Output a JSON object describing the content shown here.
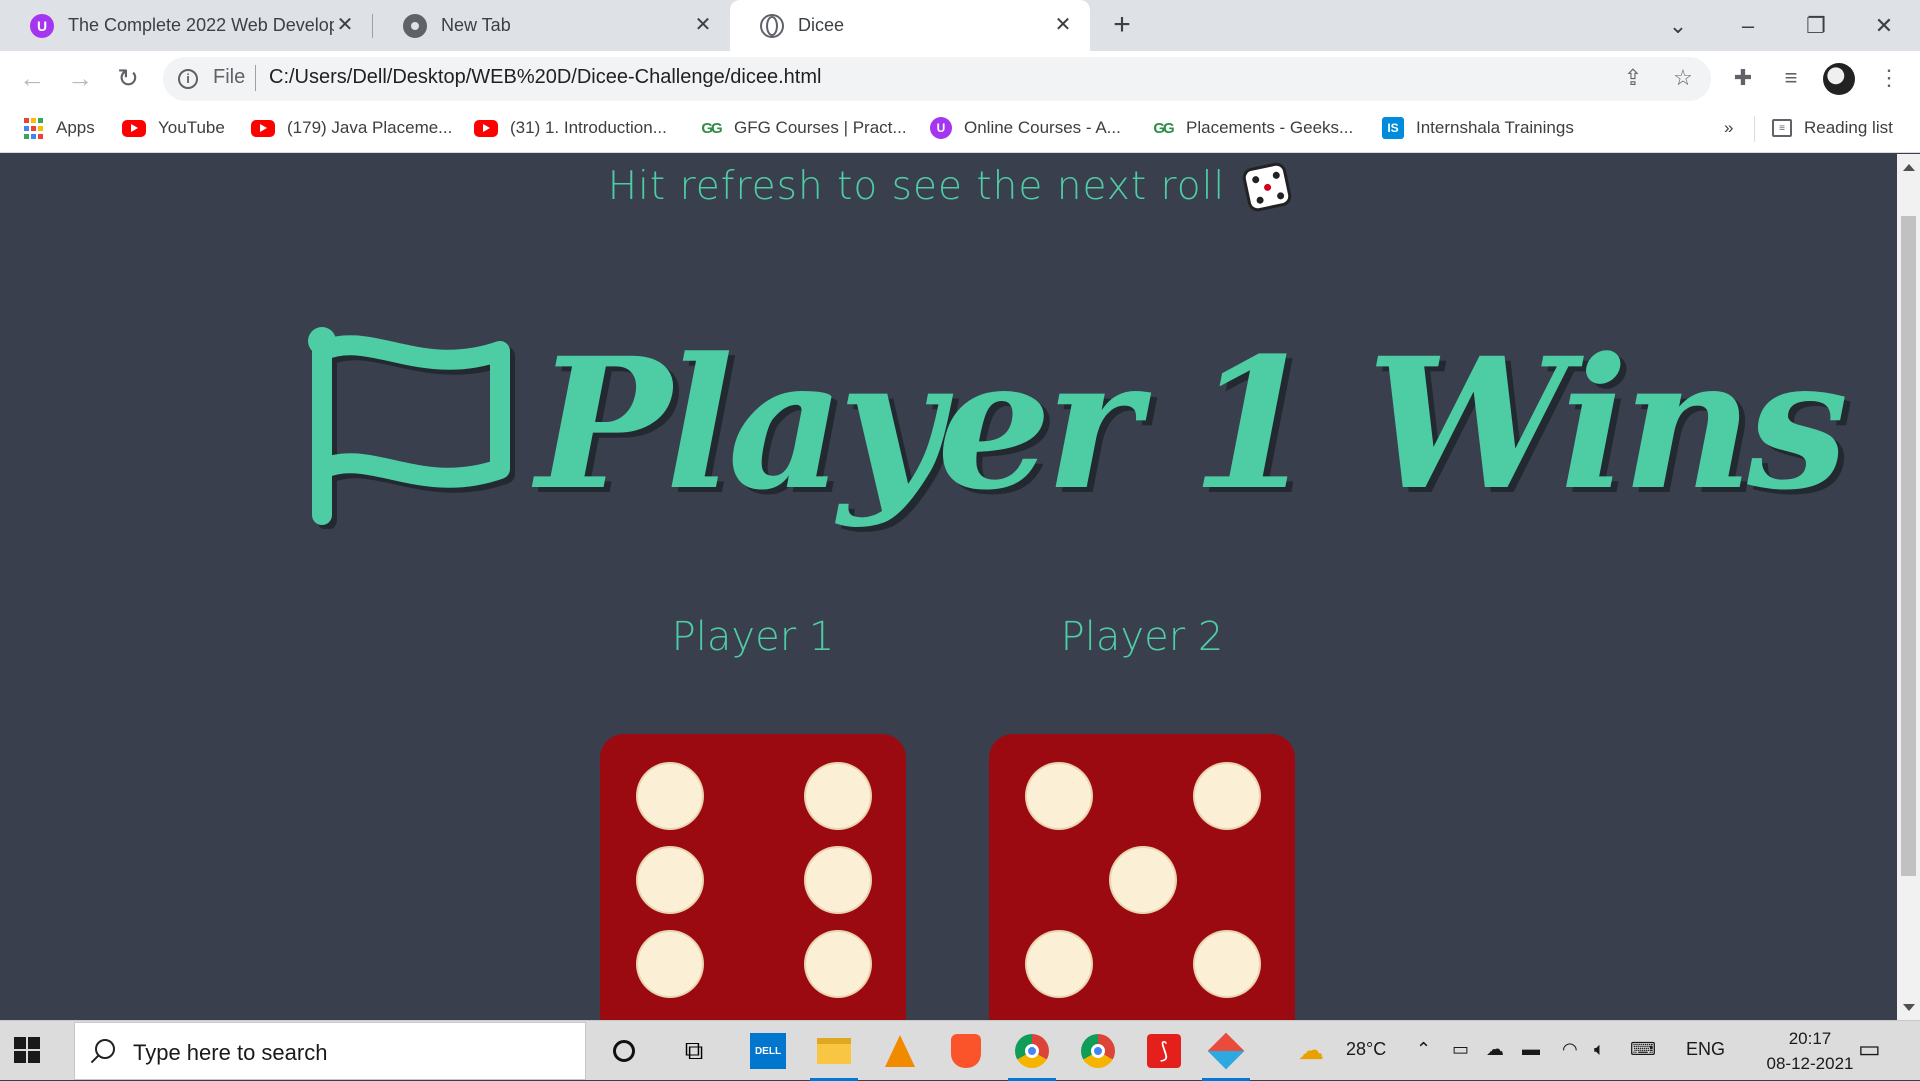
{
  "browser": {
    "tabs": [
      {
        "title": "The Complete 2022 Web Develop",
        "favicon": "udemy-icon",
        "active": false
      },
      {
        "title": "New Tab",
        "favicon": "chrome-icon",
        "active": false
      },
      {
        "title": "Dicee",
        "favicon": "globe-icon",
        "active": true
      }
    ],
    "new_tab_label": "+",
    "address": {
      "scheme_label": "File",
      "url": "C:/Users/Dell/Desktop/WEB%20D/Dicee-Challenge/dicee.html"
    },
    "bookmarks": [
      {
        "label": "Apps",
        "icon": "apps-grid-icon"
      },
      {
        "label": "YouTube",
        "icon": "youtube-icon"
      },
      {
        "label": "(179) Java Placeme...",
        "icon": "youtube-icon"
      },
      {
        "label": "(31) 1. Introduction...",
        "icon": "youtube-icon"
      },
      {
        "label": "GFG Courses | Pract...",
        "icon": "gfg-icon"
      },
      {
        "label": "Online Courses - A...",
        "icon": "udemy-icon"
      },
      {
        "label": "Placements - Geeks...",
        "icon": "gfg-icon"
      },
      {
        "label": "Internshala Trainings",
        "icon": "internshala-icon"
      }
    ],
    "bookmarks_overflow": "»",
    "reading_list_label": "Reading list"
  },
  "page": {
    "refresh_hint": "Hit refresh to see the next roll",
    "winner_text": "Player 1 Wins",
    "players": [
      {
        "label": "Player 1",
        "die_value": 6
      },
      {
        "label": "Player 2",
        "die_value": 5
      }
    ],
    "colors": {
      "background": "#393f4d",
      "accent": "#4ecca3",
      "die": "#9b0a10",
      "pip": "#fbefd6"
    }
  },
  "taskbar": {
    "search_placeholder": "Type here to search",
    "weather": "28°C",
    "language": "ENG",
    "time": "20:17",
    "date": "08-12-2021"
  }
}
